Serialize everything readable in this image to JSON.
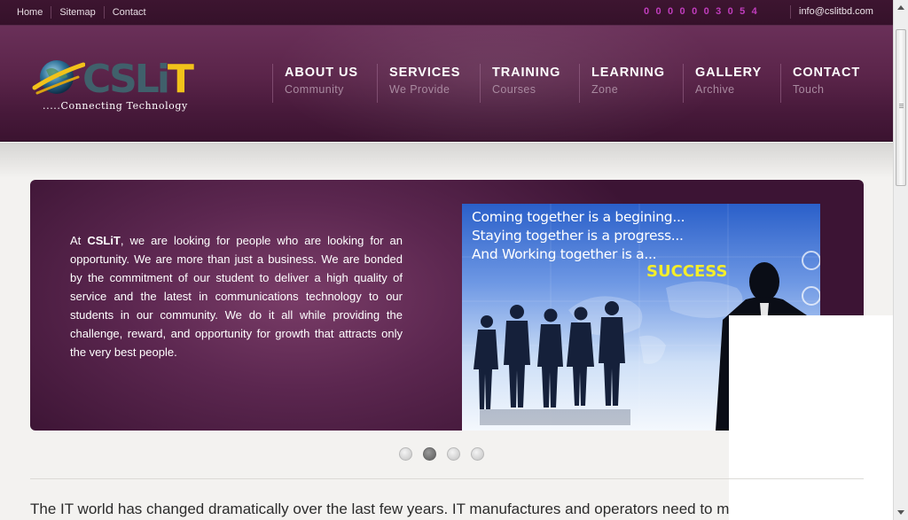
{
  "topbar": {
    "links": [
      "Home",
      "Sitemap",
      "Contact"
    ],
    "counter": "0000003054",
    "email": "info@cslitbd.com",
    "counter_color": "#c03dbd"
  },
  "logo": {
    "text_cs": "CS",
    "text_li": "Li",
    "text_t": "T",
    "tagline": ".....Connecting Technology",
    "brand_colors": {
      "teal": "#40606b",
      "gold": "#f2c21a"
    }
  },
  "nav": [
    {
      "title": "ABOUT US",
      "sub": "Community"
    },
    {
      "title": "SERVICES",
      "sub": "We Provide"
    },
    {
      "title": "TRAINING",
      "sub": "Courses"
    },
    {
      "title": "LEARNING",
      "sub": "Zone"
    },
    {
      "title": "GALLERY",
      "sub": "Archive"
    },
    {
      "title": "CONTACT",
      "sub": "Touch"
    }
  ],
  "slider": {
    "text_prefix": "At ",
    "text_brand": "CSLiT",
    "text_body": ", we are looking for people who are looking for an opportunity. We are more than just a business. We are bonded by the commitment of our student to deliver a high quality of service and the latest in communications technology to our students in our community. We do it all while providing the challenge, reward, and opportunity for growth that attracts only the very best people.",
    "image_lines": [
      "Coming together is a begining...",
      "Staying together is a progress...",
      "And Working together is a..."
    ],
    "image_highlight": "SUCCESS",
    "dots": {
      "count": 4,
      "active_index": 1
    }
  },
  "intro_text": "The IT world has changed dramatically over the last few years. IT manufactures and operators need to m",
  "icons": [
    "globe-logo-icon",
    "scroll-up-arrow-icon",
    "scroll-down-arrow-icon"
  ]
}
